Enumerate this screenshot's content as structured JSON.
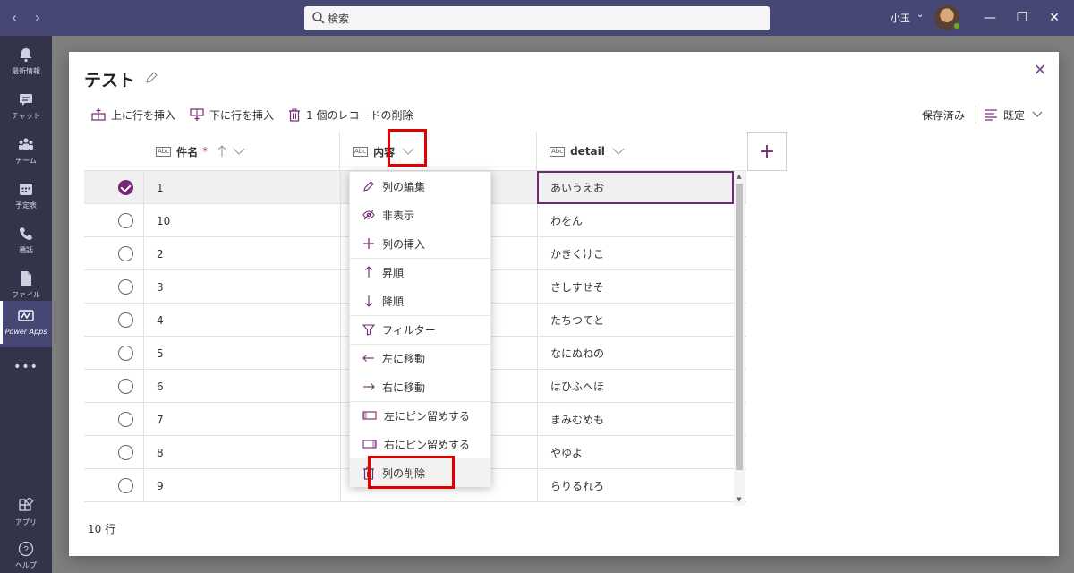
{
  "titlebar": {
    "back": "‹",
    "forward": "›",
    "search_placeholder": "検索",
    "user_name": "小玉",
    "user_chevron": "⌄",
    "minimize": "—",
    "maximize": "❐",
    "close": "✕"
  },
  "rail": {
    "items": [
      {
        "label": "最新情報",
        "icon": "bell-icon"
      },
      {
        "label": "チャット",
        "icon": "chat-icon"
      },
      {
        "label": "チーム",
        "icon": "teams-icon"
      },
      {
        "label": "予定表",
        "icon": "calendar-icon"
      },
      {
        "label": "通話",
        "icon": "phone-icon"
      },
      {
        "label": "ファイル",
        "icon": "file-icon"
      },
      {
        "label": "Power Apps",
        "icon": "powerapps-icon"
      },
      {
        "label": "•••",
        "icon": "more-icon"
      },
      {
        "label": "アプリ",
        "icon": "apps-icon"
      },
      {
        "label": "ヘルプ",
        "icon": "help-icon"
      }
    ]
  },
  "dialog": {
    "title": "テスト",
    "close": "✕",
    "toolbar": {
      "insert_above": "上に行を挿入",
      "insert_below": "下に行を挿入",
      "delete_records": "1 個のレコードの削除",
      "saved": "保存済み",
      "view": "既定"
    },
    "columns": [
      {
        "abc": "Abc",
        "name": "件名",
        "required": "*"
      },
      {
        "abc": "Abc",
        "name": "内容"
      },
      {
        "abc": "Abc",
        "name": "detail"
      }
    ],
    "add_column": "+",
    "rows": [
      {
        "subject": "1",
        "detail": "あいうえお"
      },
      {
        "subject": "10",
        "detail": "わをん"
      },
      {
        "subject": "2",
        "detail": "かきくけこ"
      },
      {
        "subject": "3",
        "detail": "さしすせそ"
      },
      {
        "subject": "4",
        "detail": "たちつてと"
      },
      {
        "subject": "5",
        "detail": "なにぬねの"
      },
      {
        "subject": "6",
        "detail": "はひふへほ"
      },
      {
        "subject": "7",
        "detail": "まみむめも"
      },
      {
        "subject": "8",
        "detail": "やゆよ"
      },
      {
        "subject": "9",
        "detail": "らりるれろ"
      }
    ],
    "row_count": "10 行"
  },
  "column_menu": {
    "items": [
      {
        "label": "列の編集",
        "icon": "pencil-icon"
      },
      {
        "label": "非表示",
        "icon": "hide-icon"
      },
      {
        "label": "列の挿入",
        "icon": "plus-icon"
      },
      {
        "label": "昇順",
        "icon": "arrow-up-icon"
      },
      {
        "label": "降順",
        "icon": "arrow-down-icon"
      },
      {
        "label": "フィルター",
        "icon": "filter-icon"
      },
      {
        "label": "左に移動",
        "icon": "arrow-left-icon"
      },
      {
        "label": "右に移動",
        "icon": "arrow-right-icon"
      },
      {
        "label": "左にピン留めする",
        "icon": "pin-left-icon"
      },
      {
        "label": "右にピン留めする",
        "icon": "pin-right-icon"
      },
      {
        "label": "列の削除",
        "icon": "trash-icon"
      }
    ]
  },
  "colors": {
    "teams_header": "#464775",
    "rail": "#33344a",
    "accent": "#742774",
    "highlight": "#e00000"
  }
}
